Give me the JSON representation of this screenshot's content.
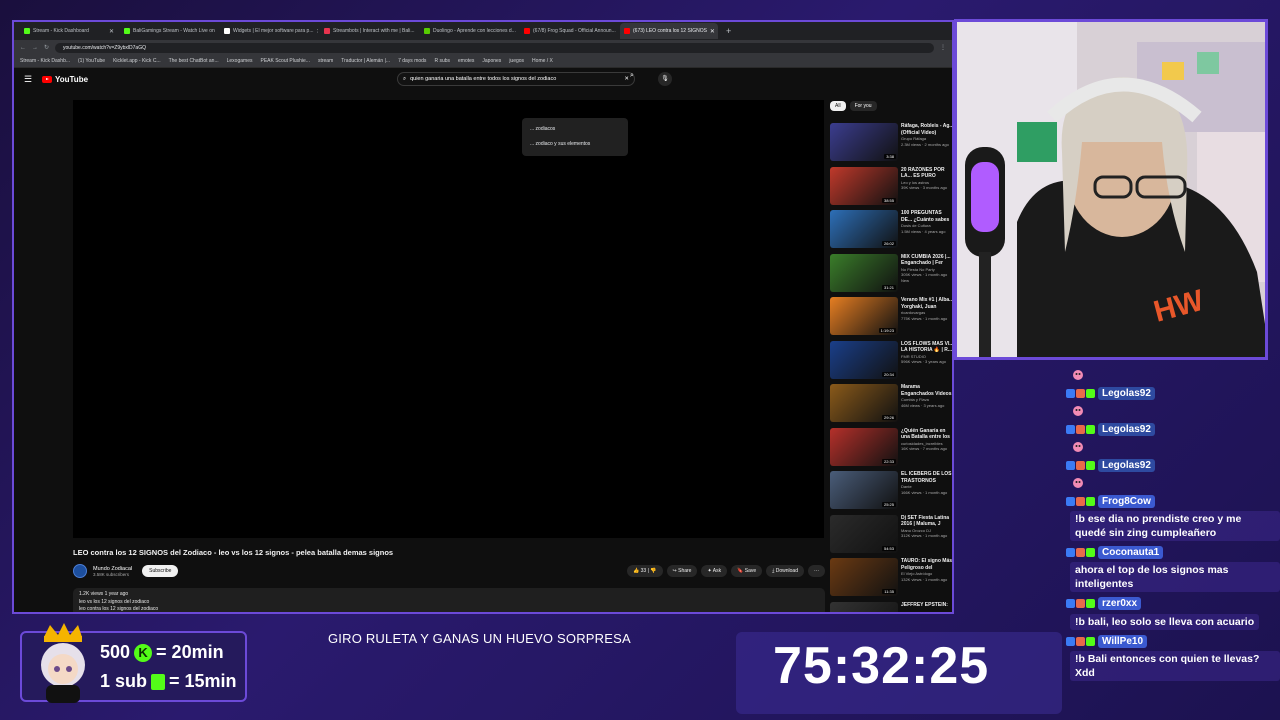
{
  "browser": {
    "tabs": [
      {
        "label": "Stream - Kick Dashboard",
        "color": "#53fc18"
      },
      {
        "label": "BaliGamings Stream - Watch Live on",
        "color": "#53fc18"
      },
      {
        "label": "Widgets | El mejor software para p...",
        "color": "#ffffff"
      },
      {
        "label": "Streambots | Interact with me | Bali...",
        "color": "#e8344e"
      },
      {
        "label": "Duolingo - Aprende con lecciones d...",
        "color": "#58cc02"
      },
      {
        "label": "(67/8) Frog Squad - Official Announ...",
        "color": "#ff0000"
      },
      {
        "label": "(673) LEO contra los 12 SIGNOS",
        "color": "#ff0000",
        "active": true
      }
    ],
    "new_tab": "+",
    "url": "youtube.com/watch?v=Z9ybxlD7aGQ",
    "bookmarks": [
      "Stream - Kick Dashb...",
      "(1) YouTube",
      "Kicklet.app - Kick C...",
      "The best ChatBot an...",
      "Lexogames",
      "PEAK Scout Plushie...",
      "stream",
      "Traductor | Alemán |...",
      "7 days mods",
      "R subs",
      "emotes",
      "Japones",
      "juegos",
      "Home / X"
    ]
  },
  "youtube": {
    "logo": "YouTube",
    "search_query": "quien ganaria una batalla entre todos los signos del zodiaco",
    "suggestions": [
      "... zodiacos",
      "... zodiaco y sus elementos"
    ],
    "video_title": "LEO contra los 12 SIGNOS del Zodiaco - leo vs los 12 signos - pelea batalla demas signos",
    "channel": "Mundo Zodiacal",
    "subscribers": "3.58K subscribers",
    "subscribe": "Subscribe",
    "likes": "33",
    "share": "Share",
    "ask": "Ask",
    "save": "Save",
    "download": "Download",
    "more": "···",
    "desc_meta": "1.2K views  1 year ago",
    "desc_line1": "leo vs los 12 signos del zodiaco",
    "desc_line2": "leo contra los 12 signos del zodiaco",
    "filters": [
      "All",
      "For you"
    ],
    "recommendations": [
      {
        "title": "Ráfaga, Robleis - Ag... (Official Video)",
        "channel": "Grupo Ráfaga",
        "meta": "2.3M views · 2 months ago",
        "duration": "3:38",
        "color": "#3b3d8f"
      },
      {
        "title": "20 RAZONES POR LA... ES PURO FUEGO, PEL...",
        "channel": "Leo y los astros",
        "meta": "39K views · 3 months ago",
        "duration": "38:55",
        "color": "#c0392b"
      },
      {
        "title": "100 PREGUNTAS DE... ¿Cuánto sabes de es...",
        "channel": "Dosis de Cultura",
        "meta": "1.5M views · 4 years ago",
        "duration": "26:02",
        "color": "#2d6fb8"
      },
      {
        "title": "MIX CUMBIA 2026 |... Enganchado | Fer Pa...",
        "channel": "No Fiesta No Party",
        "meta": "305K views · 1 month ago",
        "duration": "31:21",
        "color": "#3a7d2a",
        "badge": "New"
      },
      {
        "title": "Verano Mix #1 | Alba... Yorghaki, Juan Magá...",
        "channel": "ricardovargas",
        "meta": "775K views · 1 month ago",
        "duration": "1:19:23",
        "color": "#e67e22"
      },
      {
        "title": "LOS FLOWS MÁS VI... LA HISTORIA 🔥 | R...",
        "channel": "FMR STUDIO",
        "meta": "596K views · 3 years ago",
        "duration": "20:34",
        "color": "#1a3f8a"
      },
      {
        "title": "Marama Enganchados Videos Oficiales - Cumbia Pop",
        "channel": "Cumbia y Flava",
        "meta": "46M views · 3 years ago",
        "duration": "29:26",
        "color": "#8a5a1a"
      },
      {
        "title": "¿Quién Ganaría en una Batalla entre los 12 Signos del...",
        "channel": "curiosidades_increibles",
        "meta": "16K views · 7 months ago",
        "duration": "22:33",
        "color": "#b5302a"
      },
      {
        "title": "EL ICEBERG DE LOS TRASTORNOS MENTALES",
        "channel": "Dante",
        "meta": "166K views · 1 month ago",
        "duration": "25:25",
        "color": "#4a5d7a"
      },
      {
        "title": "Dj SET Fiesta Latina 2016 | Maluma, J Balvin, Yatra, Danny...",
        "channel": "Manu Orozco DJ",
        "meta": "312K views · 1 month ago",
        "duration": "54:53",
        "color": "#2b2b2b"
      },
      {
        "title": "TAURO: El signo Más Peligroso del ZODIACO\" ¿dime te...",
        "channel": "El Viejo Astrólogo",
        "meta": "132K views · 1 month ago",
        "duration": "11:35",
        "color": "#6b3a12"
      },
      {
        "title": "JEFFREY EPSTEIN:",
        "channel": "",
        "meta": "",
        "duration": "",
        "color": "#333333"
      }
    ]
  },
  "chat": {
    "messages": [
      {
        "user": "",
        "text": "",
        "emote_only": true
      },
      {
        "user": "Legolas92",
        "text": "",
        "color": "#2e4aa0"
      },
      {
        "user": "",
        "text": "",
        "emote_only": true
      },
      {
        "user": "Legolas92",
        "text": "",
        "color": "#2e4aa0"
      },
      {
        "user": "",
        "text": "",
        "emote_only": true
      },
      {
        "user": "Legolas92",
        "text": "",
        "color": "#2e4aa0"
      },
      {
        "user": "",
        "text": "",
        "emote_only": true
      },
      {
        "user": "Frog8Cow",
        "text": "!b ese dia no prendiste creo y me quedé sin zing cumpleañero",
        "color": "#3b5ad0"
      },
      {
        "user": "Coconauta1",
        "text": "ahora el top de los signos mas inteligentes",
        "color": "#3b5ad0"
      },
      {
        "user": "rzer0xx",
        "text": "!b bali, leo solo se lleva con acuario",
        "color": "#3b5ad0"
      },
      {
        "user": "WillPe10",
        "text": "!b Bali entonces con quien te llevas? Xdd",
        "color": "#3b5ad0"
      }
    ]
  },
  "overlay": {
    "promo_line1_amount": "500",
    "promo_line1_rest": "= 20min",
    "promo_line2_amount": "1 sub",
    "promo_line2_rest": "= 15min",
    "kick_glyph": "K",
    "ticker": "GIRO RULETA Y GANAS UN HUEVO SORPRESA",
    "timer": "75:32:25"
  }
}
